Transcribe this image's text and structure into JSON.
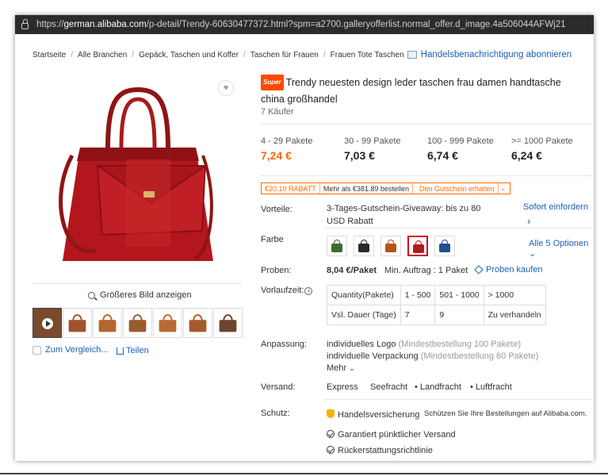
{
  "browser": {
    "url_prefix": "https://",
    "url_host": "german.alibaba.com",
    "url_path": "/p-detail/Trendy-60630477372.html?spm=a2700.galleryofferlist.normal_offer.d_image.4a506044AFWj21"
  },
  "breadcrumb": {
    "items": [
      "Startseite",
      "Alle Branchen",
      "Gepäck, Taschen und Koffer",
      "Taschen für Frauen",
      "Frauen Tote Taschen"
    ],
    "subscribe_label": "Handelsbenachrichtigung abonnieren"
  },
  "gallery": {
    "zoom_label": "Größeres Bild anzeigen",
    "thumb_colors": [
      "#7b4a2c",
      "#a0522d",
      "#b5652e",
      "#9a5a30",
      "#b86a35",
      "#a65a2a",
      "#6b4530"
    ],
    "compare_label": "Zum Vergleich...",
    "share_label": "Teilen"
  },
  "product": {
    "badge": "Super",
    "title": "Trendy neuesten design leder taschen frau damen handtasche china großhandel",
    "buyers": "7 Käufer",
    "tiers": [
      {
        "range": "4 - 29 Pakete",
        "price": "7,24 €"
      },
      {
        "range": "30 - 99 Pakete",
        "price": "7,03 €"
      },
      {
        "range": "100 - 999 Pakete",
        "price": "6,74 €"
      },
      {
        "range": ">= 1000 Pakete",
        "price": "6,24 €"
      }
    ],
    "coupon": {
      "amount": "€20.10 RABATT",
      "condition": "Mehr als €381.89 bestellen",
      "action": "Den Gutschein erhalten"
    },
    "benefits": {
      "label": "Vorteile:",
      "text": "3-Tages-Gutschein-Giveaway: bis zu 80 USD Rabatt",
      "action": "Sofort einfordern",
      "arrow": "›"
    },
    "color": {
      "label": "Farbe",
      "swatches": [
        "#3e6b2e",
        "#2a2a2a",
        "#b5531d",
        "#b01c22",
        "#1f4f8f"
      ],
      "all_options": "Alle 5 Optionen",
      "chevron": "⌄"
    },
    "samples": {
      "label": "Proben:",
      "price": "8,04 €/Paket",
      "min_order": "Min. Auftrag : 1 Paket",
      "buy_label": "Proben kaufen"
    },
    "lead_time": {
      "label": "Vorlaufzeit:",
      "info": "i",
      "header": [
        "Quantity(Pakete)",
        "1 - 500",
        "501 - 1000",
        "> 1000"
      ],
      "row": [
        "Vsl. Dauer (Tage)",
        "7",
        "9",
        "Zu verhandeln"
      ]
    },
    "customization": {
      "label": "Anpassung:",
      "items": [
        {
          "name": "individuelles Logo",
          "note": "(Mindestbestellung 100 Pakete)"
        },
        {
          "name": "individuelle Verpackung",
          "note": "(Mindestbestellung 60 Pakete)"
        }
      ],
      "more": "Mehr"
    },
    "shipping": {
      "label": "Versand:",
      "methods": [
        "Express",
        "Seefracht",
        "Landfracht",
        "Luftfracht"
      ]
    },
    "protection": {
      "label": "Schutz:",
      "trade_assurance": "Handelsversicherung",
      "trade_note": "Schützen Sie Ihre Bestellungen auf Alibaba.com.",
      "items": [
        "Garantiert pünktlicher Versand",
        "Rückerstattungsrichtlinie"
      ]
    }
  }
}
